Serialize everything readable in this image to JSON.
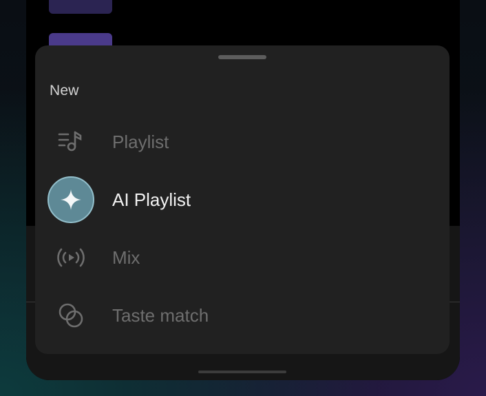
{
  "sheet": {
    "title": "New",
    "items": [
      {
        "label": "Playlist",
        "icon": "playlist-icon",
        "active": false
      },
      {
        "label": "AI Playlist",
        "icon": "sparkle-icon",
        "active": true
      },
      {
        "label": "Mix",
        "icon": "broadcast-play-icon",
        "active": false
      },
      {
        "label": "Taste match",
        "icon": "overlapping-circles-icon",
        "active": false
      }
    ]
  },
  "colors": {
    "sheet_background": "#212121",
    "active_label": "#f2f2f2",
    "inactive_label": "#6e6e6e",
    "ai_accent": "#5e8996"
  }
}
